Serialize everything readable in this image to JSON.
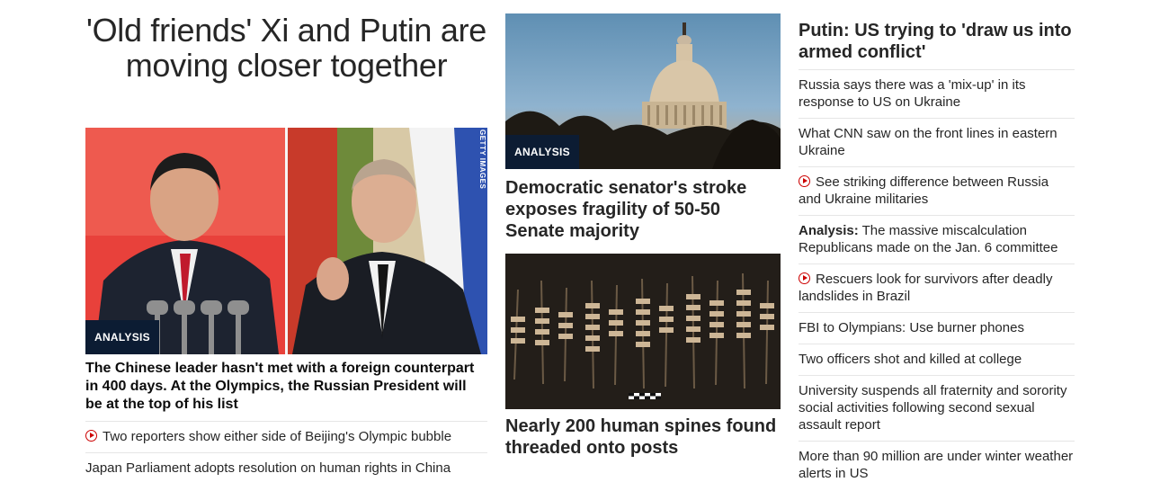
{
  "hero": {
    "headline": "'Old friends' Xi and Putin are moving closer together",
    "badge": "ANALYSIS",
    "image_credit": "GETTY IMAGES",
    "description": "The Chinese leader hasn't met with a foreign counterpart in 400 days. At the Olympics, the Russian President will be at the top of his list",
    "related": [
      {
        "text": "Two reporters show either side of Beijing's Olympic bubble",
        "video": true
      },
      {
        "text": "Japan Parliament adopts resolution on human rights in China",
        "video": false
      }
    ]
  },
  "middle": {
    "story1": {
      "badge": "ANALYSIS",
      "headline": "Democratic senator's stroke exposes fragility of 50-50 Senate majority"
    },
    "story2": {
      "headline": "Nearly 200 human spines found threaded onto posts"
    }
  },
  "right": {
    "headline": "Putin: US trying to 'draw us into armed conflict'",
    "items": [
      {
        "text": "Russia says there was a 'mix-up' in its response to US on Ukraine"
      },
      {
        "text": "What CNN saw on the front lines in eastern Ukraine"
      },
      {
        "text": "See striking difference between Russia and Ukraine militaries",
        "video": true
      },
      {
        "prefix": "Analysis:",
        "text": " The massive miscalculation Republicans made on the Jan. 6 committee"
      },
      {
        "text": "Rescuers look for survivors after deadly landslides in Brazil",
        "video": true
      },
      {
        "text": "FBI to Olympians: Use burner phones"
      },
      {
        "text": "Two officers shot and killed at college"
      },
      {
        "text": "University suspends all fraternity and sorority social activities following second sexual assault report"
      },
      {
        "text": "More than 90 million are under winter weather alerts in US"
      }
    ]
  },
  "colors": {
    "accent_red": "#cc0000",
    "badge_bg": "#0c1c33",
    "text": "#262626",
    "divider": "#e6e6e6"
  }
}
